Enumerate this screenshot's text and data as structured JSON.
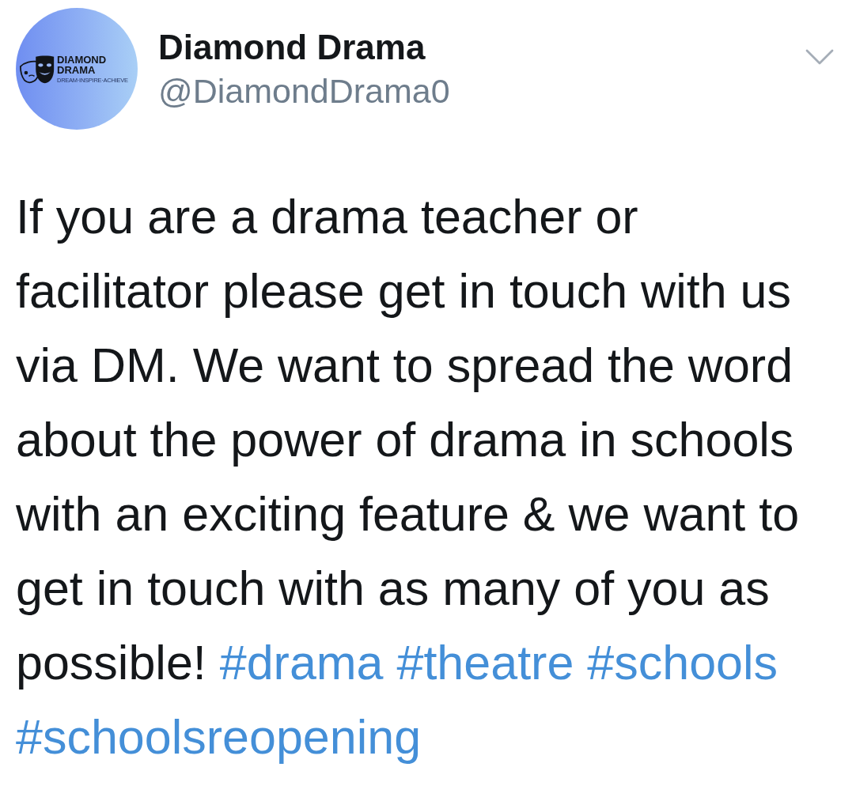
{
  "author": {
    "avatar": {
      "logo_lines": [
        "DIAMOND",
        "DRAMA",
        "DREAM·INSPIRE·ACHIEVE"
      ]
    },
    "name": "Diamond Drama",
    "handle": "@DiamondDrama0"
  },
  "tweet": {
    "text": "If you are a drama teacher or facilitator please get in touch with us via DM. We want to spread the word about the power of drama in schools with an exciting feature & we want to get in touch with as many of you as possible!",
    "hashtags": [
      "#drama",
      "#theatre",
      "#schools",
      "#schoolsreopening"
    ]
  }
}
